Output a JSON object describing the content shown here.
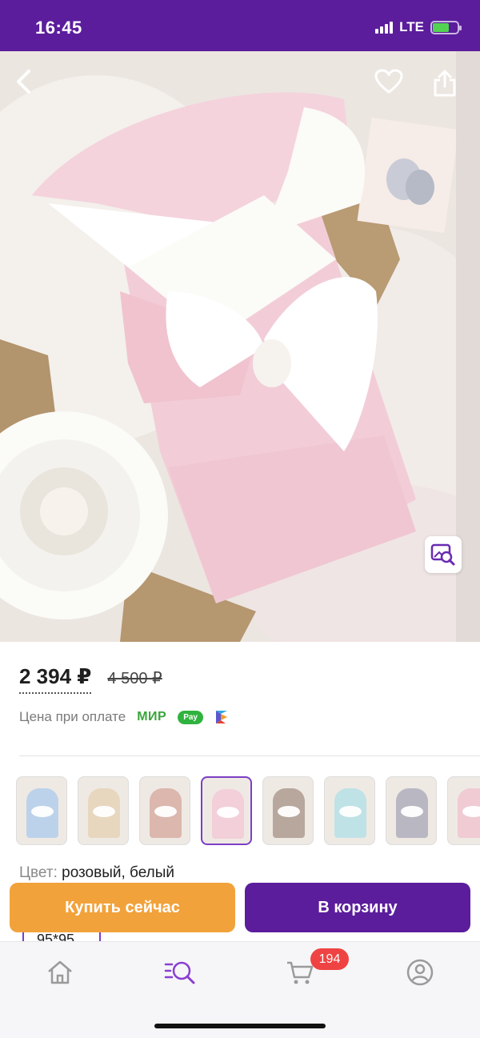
{
  "status_bar": {
    "time": "16:45",
    "network": "LTE",
    "battery_level": 0.65
  },
  "product": {
    "price_current": "2 394 ₽",
    "price_old": "4 500 ₽",
    "payment_note": "Цена при оплате",
    "payment_mir": "МИР",
    "payment_sber": "Pay",
    "color_label": "Цвет:",
    "color_value": "розовый, белый",
    "size_value": "95*95"
  },
  "swatches": [
    {
      "color": "#bcd2ea"
    },
    {
      "color": "#e8d7bf"
    },
    {
      "color": "#dcb7ad"
    },
    {
      "color": "#f3cfd9"
    },
    {
      "color": "#b7a79d"
    },
    {
      "color": "#bfe2e6"
    },
    {
      "color": "#b9b7c2"
    },
    {
      "color": "#f0cbd4"
    }
  ],
  "selected_swatch": 3,
  "actions": {
    "buy_now": "Купить сейчас",
    "add_to_cart": "В корзину"
  },
  "nav": {
    "cart_count": "194"
  },
  "colors": {
    "brand": "#5b1d9c",
    "buy": "#f2a23a",
    "accent": "#7b3fc4",
    "badge": "#ef4343"
  }
}
